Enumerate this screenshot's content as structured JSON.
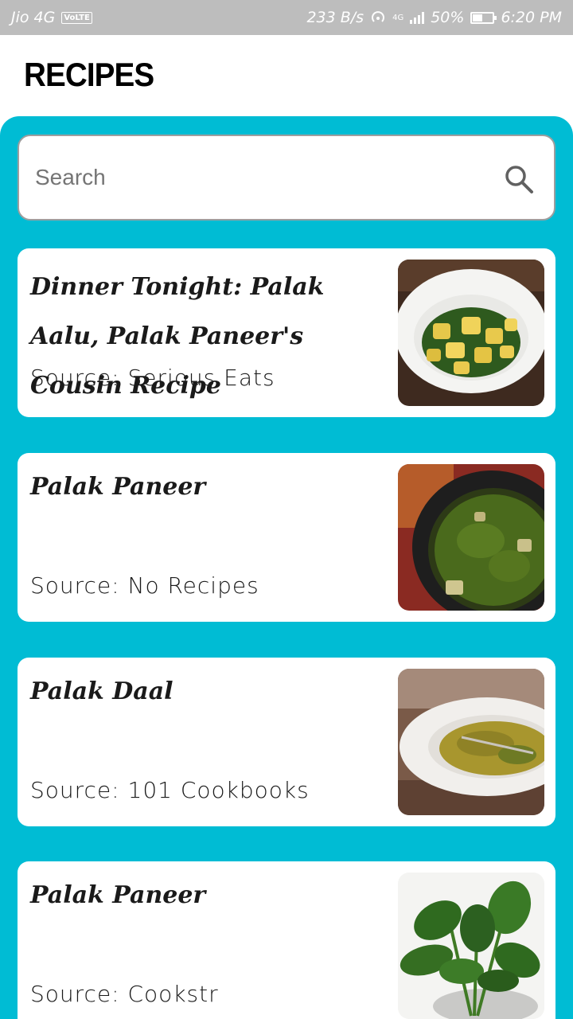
{
  "status_bar": {
    "carrier": "Jio 4G",
    "volte": "VoLTE",
    "speed": "233 B/s",
    "network_badge": "4G",
    "battery": "50%",
    "battery_level": 0.5,
    "time": "6:20 PM"
  },
  "app": {
    "title": "RECIPES",
    "accent_color": "#00bcd4"
  },
  "search": {
    "placeholder": "Search",
    "value": "",
    "icon": "search-icon"
  },
  "recipes": [
    {
      "title": "Dinner Tonight: Palak Aalu, Palak Paneer's Cousin Recipe",
      "source": "Source: Serious Eats",
      "image": "potatoes-spinach-bowl"
    },
    {
      "title": "Palak Paneer",
      "source": "Source: No Recipes",
      "image": "spinach-curry-pan"
    },
    {
      "title": "Palak Daal",
      "source": "Source: 101 Cookbooks",
      "image": "lentil-spinach-plate"
    },
    {
      "title": "Palak Paneer",
      "source": "Source: Cookstr",
      "image": "fresh-spinach-leaves"
    }
  ]
}
